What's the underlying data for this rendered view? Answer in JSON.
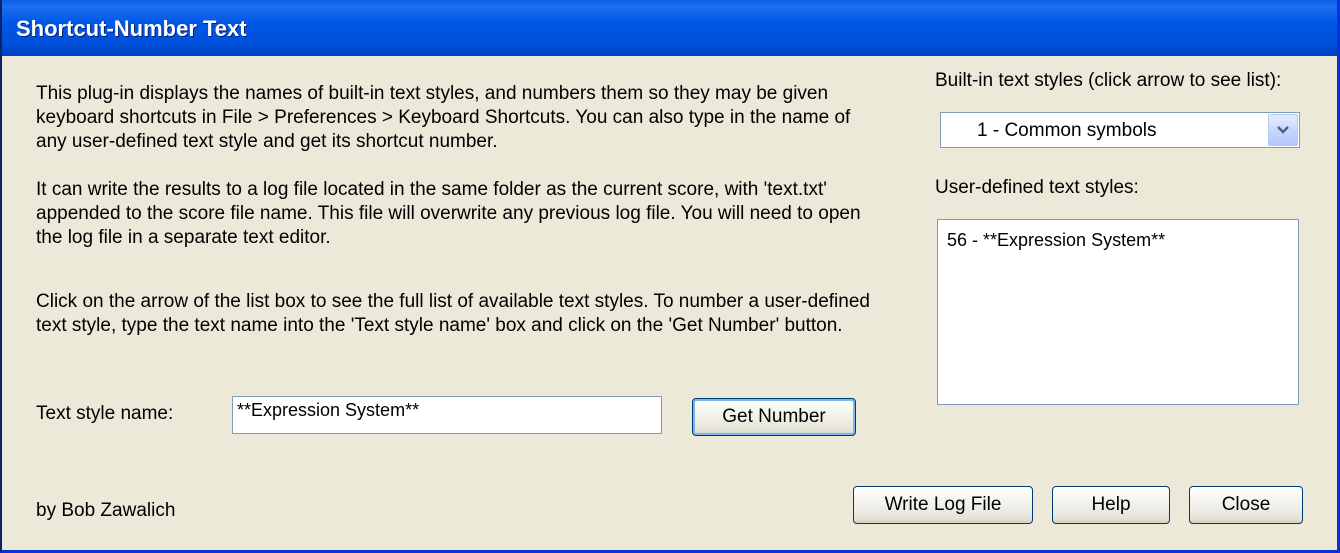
{
  "window": {
    "title": "Shortcut-Number Text"
  },
  "description": {
    "paragraph1": "This plug-in displays the names of built-in text styles, and numbers them so they may be given keyboard shortcuts in File > Preferences > Keyboard Shortcuts. You can also type in the name of any user-defined text style and get its shortcut number.",
    "paragraph2": "It can write the results to a log file located in the same folder as the current score, with 'text.txt' appended to the score file name. This file will overwrite any previous log file. You will need to open the log file in a separate text editor.",
    "paragraph3": "Click on the arrow of the list box to see the full list of available text styles. To number a user-defined text style, type the text name into the 'Text style name' box and click on the 'Get Number' button."
  },
  "text_style_name": {
    "label": "Text style name:",
    "value": "**Expression System**"
  },
  "get_number_button": "Get Number",
  "builtin_styles": {
    "label": "Built-in text styles (click arrow to see list):",
    "selected": "1 - Common symbols"
  },
  "user_defined_styles": {
    "label": "User-defined text styles:",
    "items": [
      "56 - **Expression System**"
    ]
  },
  "author": "by Bob Zawalich",
  "buttons": {
    "write_log": "Write Log File",
    "help": "Help",
    "close": "Close"
  },
  "colors": {
    "titlebar": "#0058E6",
    "window_bg": "#ECE9D8",
    "button_border": "#003C74"
  }
}
